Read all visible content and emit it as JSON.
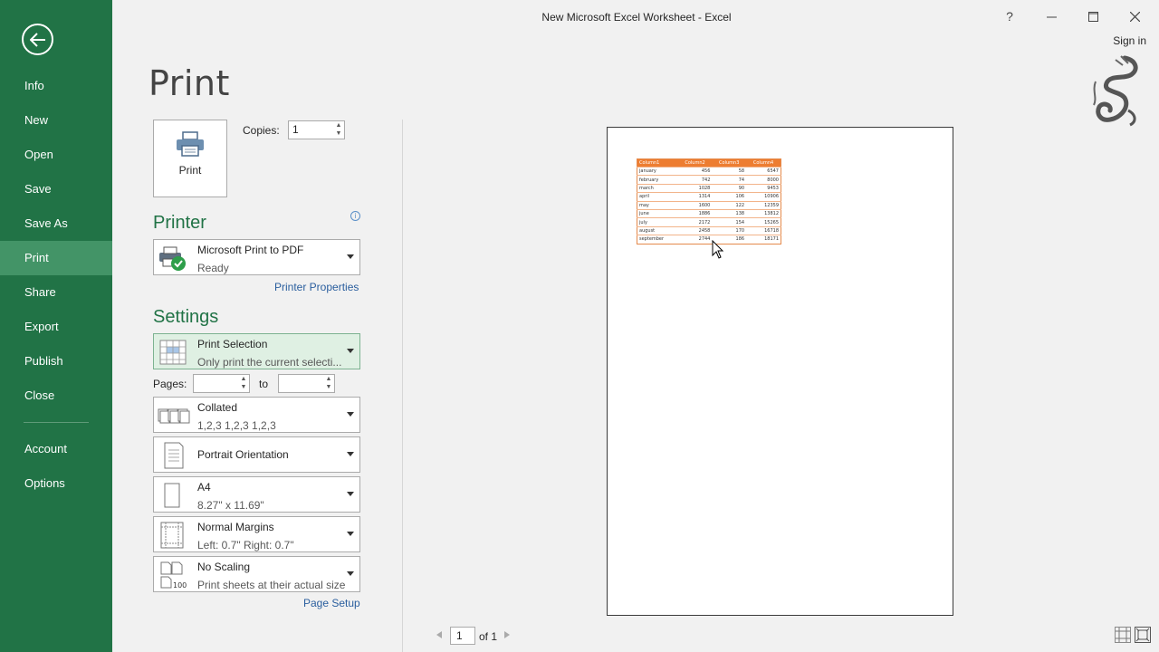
{
  "window": {
    "title": "New Microsoft Excel Worksheet - Excel",
    "help": "?",
    "sign_in": "Sign in"
  },
  "sidebar": {
    "items": [
      {
        "label": "Info"
      },
      {
        "label": "New"
      },
      {
        "label": "Open"
      },
      {
        "label": "Save"
      },
      {
        "label": "Save As"
      },
      {
        "label": "Print",
        "active": true
      },
      {
        "label": "Share"
      },
      {
        "label": "Export"
      },
      {
        "label": "Publish"
      },
      {
        "label": "Close"
      }
    ],
    "bottom_items": [
      {
        "label": "Account"
      },
      {
        "label": "Options"
      }
    ]
  },
  "print": {
    "title": "Print",
    "button_label": "Print",
    "copies_label": "Copies:",
    "copies_value": "1"
  },
  "printer": {
    "heading": "Printer",
    "name": "Microsoft Print to PDF",
    "status": "Ready",
    "properties_link": "Printer Properties"
  },
  "settings": {
    "heading": "Settings",
    "what": {
      "title": "Print Selection",
      "desc": "Only print the current selecti..."
    },
    "pages_label": "Pages:",
    "to_label": "to",
    "collation": {
      "title": "Collated",
      "desc": "1,2,3    1,2,3    1,2,3"
    },
    "orientation": {
      "title": "Portrait Orientation"
    },
    "paper": {
      "title": "A4",
      "desc": "8.27\" x 11.69\""
    },
    "margins": {
      "title": "Normal Margins",
      "desc": "Left:  0.7\"    Right:  0.7\""
    },
    "scaling": {
      "title": "No Scaling",
      "desc": "Print sheets at their actual size"
    },
    "page_setup_link": "Page Setup"
  },
  "preview": {
    "headers": [
      "Column1",
      "Column2",
      "Column3",
      "Column4"
    ],
    "rows": [
      [
        "january",
        "456",
        "58",
        "6547"
      ],
      [
        "february",
        "742",
        "74",
        "8000"
      ],
      [
        "march",
        "1028",
        "90",
        "9453"
      ],
      [
        "april",
        "1314",
        "106",
        "10906"
      ],
      [
        "may",
        "1600",
        "122",
        "12359"
      ],
      [
        "june",
        "1886",
        "138",
        "13812"
      ],
      [
        "july",
        "2172",
        "154",
        "15265"
      ],
      [
        "august",
        "2458",
        "170",
        "16718"
      ],
      [
        "september",
        "2744",
        "186",
        "18171"
      ]
    ],
    "page_current": "1",
    "page_of": "of 1"
  },
  "colors": {
    "sidebar": "#217346",
    "sidebar_active": "#439467",
    "table_header": "#ed7d31"
  }
}
